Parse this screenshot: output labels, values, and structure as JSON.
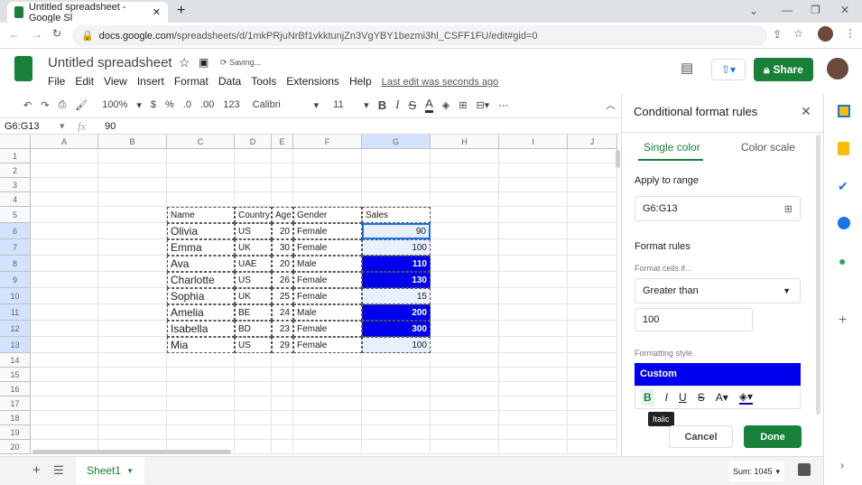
{
  "browser": {
    "tab_title": "Untitled spreadsheet - Google Sl",
    "url_domain": "docs.google.com",
    "url_path": "/spreadsheets/d/1mkPRjuNrBf1vkktunjZn3VgYBY1bezmi3hl_CSFF1FU/edit#gid=0"
  },
  "doc": {
    "title": "Untitled spreadsheet",
    "saving": "Saving...",
    "share": "Share",
    "last_edit": "Last edit was seconds ago",
    "menu": [
      "File",
      "Edit",
      "View",
      "Insert",
      "Format",
      "Data",
      "Tools",
      "Extensions",
      "Help"
    ]
  },
  "toolbar": {
    "zoom": "100%",
    "currency": "$",
    "percent": "%",
    "dec_less": ".0",
    "dec_more": ".00",
    "format": "123",
    "font": "Calibri",
    "size": "11"
  },
  "formula": {
    "name_box": "G6:G13",
    "fx": "fx",
    "value": "90"
  },
  "columns": [
    "A",
    "B",
    "C",
    "D",
    "E",
    "F",
    "G",
    "H",
    "I",
    "J"
  ],
  "rows": [
    "1",
    "2",
    "3",
    "4",
    "5",
    "6",
    "7",
    "8",
    "9",
    "10",
    "11",
    "12",
    "13",
    "14",
    "15",
    "16",
    "17",
    "18",
    "19",
    "20"
  ],
  "table": {
    "headers": [
      "Name",
      "Country",
      "Age",
      "Gender",
      "Sales"
    ],
    "rows": [
      [
        "Olivia",
        "US",
        "20",
        "Female",
        "90"
      ],
      [
        "Emma",
        "UK",
        "30",
        "Female",
        "100"
      ],
      [
        "Ava",
        "UAE",
        "20",
        "Male",
        "110"
      ],
      [
        "Charlotte",
        "US",
        "26",
        "Female",
        "130"
      ],
      [
        "Sophia",
        "UK",
        "25",
        "Female",
        "15"
      ],
      [
        "Amelia",
        "BE",
        "24",
        "Male",
        "200"
      ],
      [
        "Isabella",
        "BD",
        "23",
        "Female",
        "300"
      ],
      [
        "Mia",
        "US",
        "29",
        "Female",
        "100"
      ]
    ]
  },
  "colors": {
    "highlight": "#0000ee",
    "selection": "#e8f0fe",
    "accent": "#188038"
  },
  "panel": {
    "title": "Conditional format rules",
    "tabs": [
      "Single color",
      "Color scale"
    ],
    "apply_label": "Apply to range",
    "range": "G6:G13",
    "rules_label": "Format rules",
    "cells_if": "Format cells if...",
    "condition": "Greater than",
    "value": "100",
    "style_label": "Formatting style",
    "style_preview": "Custom",
    "tooltip": "Italic",
    "cancel": "Cancel",
    "done": "Done"
  },
  "footer": {
    "sheet": "Sheet1",
    "sum": "Sum: 1045"
  }
}
